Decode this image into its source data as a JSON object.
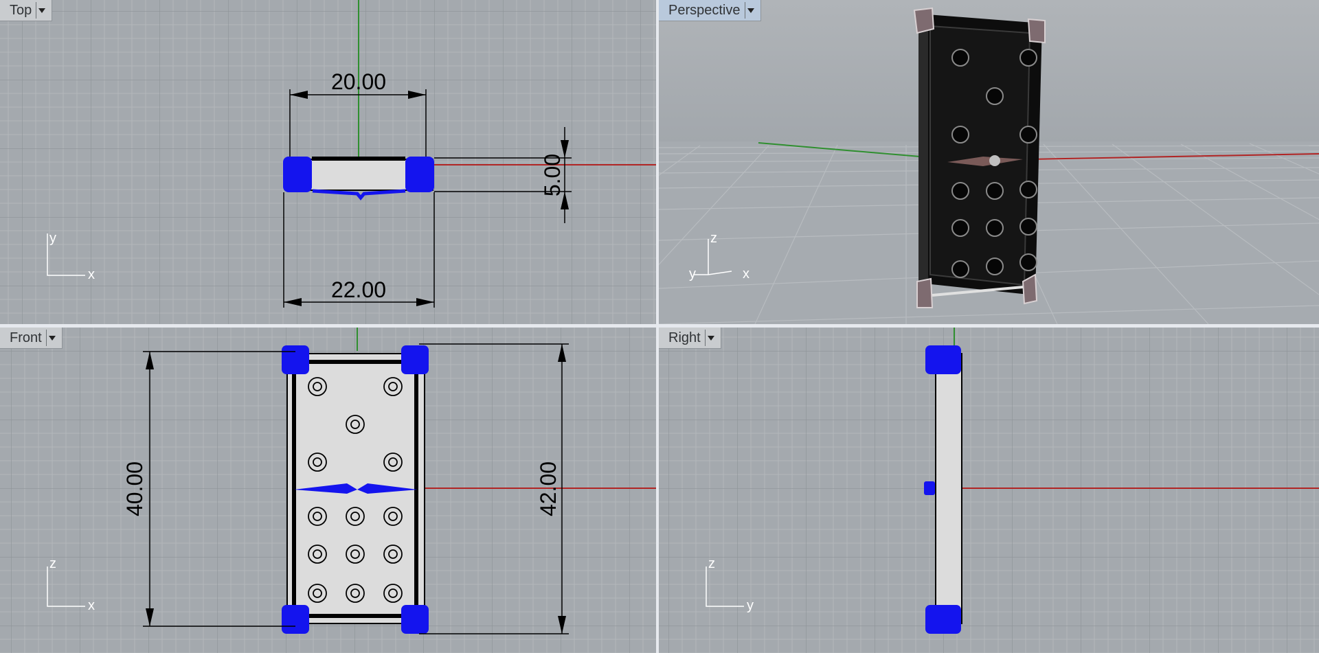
{
  "viewports": {
    "top": {
      "title": "Top",
      "axis_labels": {
        "vertical": "y",
        "horizontal": "x"
      }
    },
    "perspective": {
      "title": "Perspective",
      "axis_labels": {
        "vertical": "z",
        "left": "y",
        "right": "x"
      }
    },
    "front": {
      "title": "Front",
      "axis_labels": {
        "vertical": "z",
        "horizontal": "x"
      }
    },
    "right": {
      "title": "Right",
      "axis_labels": {
        "vertical": "z",
        "horizontal": "y"
      }
    }
  },
  "dimensions": {
    "top_width_inner": "20.00",
    "top_depth": "5.00",
    "top_width_outer": "22.00",
    "front_height_inner": "40.00",
    "front_height_outer": "42.00"
  },
  "colors": {
    "viewport_bg": "#a4a9ae",
    "grid_minor": "#b3b7bb",
    "grid_major": "#8d9297",
    "x_axis": "#b12424",
    "y_axis": "#2f8f2f",
    "selection_blue": "#1414ee",
    "object_fill": "#dcdcdc"
  },
  "icons": {
    "dropdown": "triangle-down-icon"
  }
}
